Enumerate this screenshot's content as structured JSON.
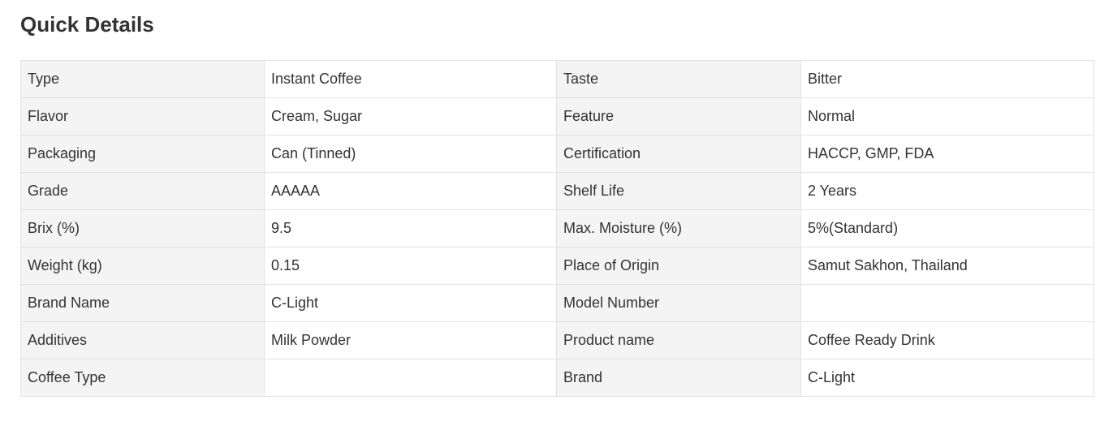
{
  "section": {
    "title": "Quick Details"
  },
  "details": {
    "rows": [
      [
        {
          "label": "Type",
          "value": "Instant Coffee"
        },
        {
          "label": "Taste",
          "value": "Bitter"
        }
      ],
      [
        {
          "label": "Flavor",
          "value": "Cream, Sugar"
        },
        {
          "label": "Feature",
          "value": "Normal"
        }
      ],
      [
        {
          "label": "Packaging",
          "value": "Can (Tinned)"
        },
        {
          "label": "Certification",
          "value": "HACCP, GMP, FDA"
        }
      ],
      [
        {
          "label": "Grade",
          "value": "AAAAA"
        },
        {
          "label": "Shelf Life",
          "value": "2 Years"
        }
      ],
      [
        {
          "label": "Brix (%)",
          "value": "9.5"
        },
        {
          "label": "Max. Moisture (%)",
          "value": "5%(Standard)"
        }
      ],
      [
        {
          "label": "Weight (kg)",
          "value": "0.15"
        },
        {
          "label": "Place of Origin",
          "value": "Samut Sakhon, Thailand"
        }
      ],
      [
        {
          "label": "Brand Name",
          "value": "C-Light"
        },
        {
          "label": "Model Number",
          "value": ""
        }
      ],
      [
        {
          "label": "Additives",
          "value": "Milk Powder"
        },
        {
          "label": "Product name",
          "value": "Coffee Ready Drink"
        }
      ],
      [
        {
          "label": "Coffee Type",
          "value": ""
        },
        {
          "label": "Brand",
          "value": "C-Light"
        }
      ]
    ]
  }
}
